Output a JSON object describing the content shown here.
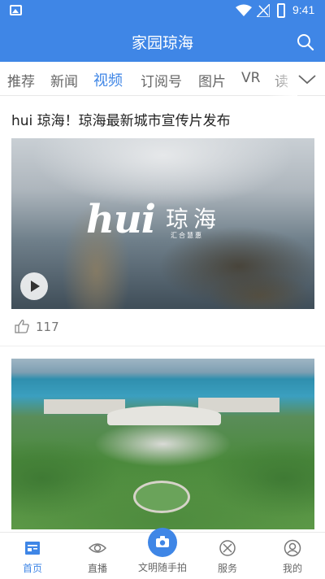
{
  "status_bar": {
    "time": "9:41"
  },
  "header": {
    "title": "家园琼海"
  },
  "tabs": [
    {
      "label": "推荐"
    },
    {
      "label": "新闻"
    },
    {
      "label": "视频"
    },
    {
      "label": "订阅号"
    },
    {
      "label": "图片"
    },
    {
      "label": "VR"
    },
    {
      "label": "读"
    }
  ],
  "active_tab": "视频",
  "feed": [
    {
      "title": "hui 琼海！琼海最新城市宣传片发布",
      "overlay": {
        "logo_text": "hui",
        "logo_cn": "琼海",
        "logo_sub": "汇合慧惠"
      },
      "likes": "117"
    },
    {
      "title": ""
    }
  ],
  "bottom_nav": [
    {
      "label": "首页"
    },
    {
      "label": "直播"
    },
    {
      "label": "文明随手拍"
    },
    {
      "label": "服务"
    },
    {
      "label": "我的"
    }
  ],
  "colors": {
    "accent": "#3f86e6",
    "text": "#222222",
    "muted": "#666666"
  }
}
